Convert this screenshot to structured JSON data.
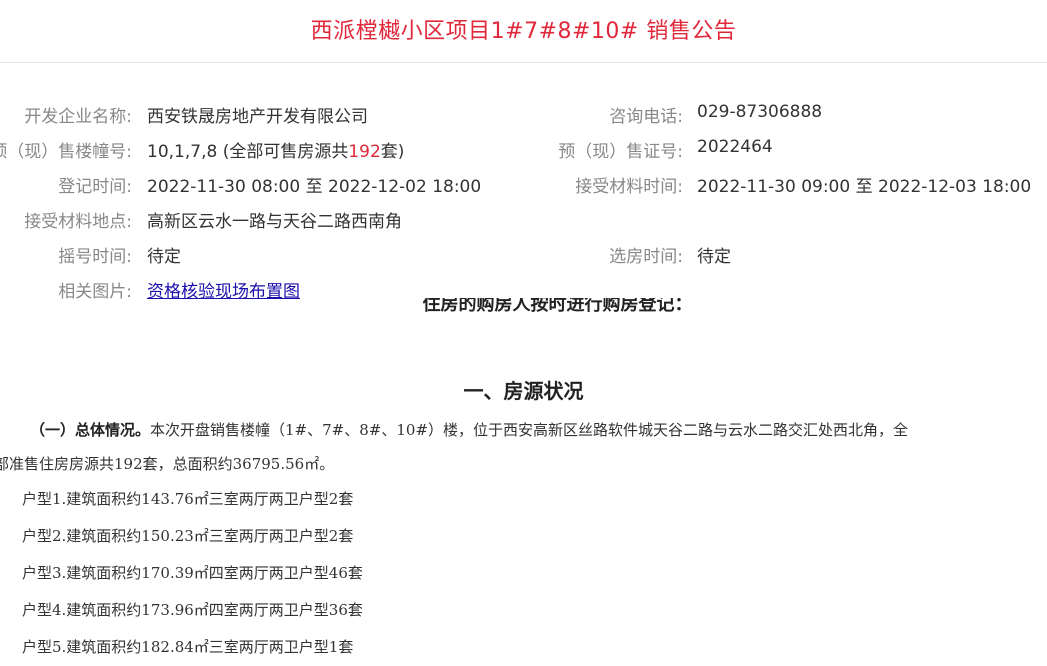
{
  "header": {
    "title": "西派樘樾小区项目1#7#8#10# 销售公告"
  },
  "info": {
    "developer_label": "开发企业名称:",
    "developer_value": "西安铁晟房地产开发有限公司",
    "phone_label": "咨询电话:",
    "phone_value": "029-87306888",
    "buildings_label": "预（现）售楼幢号:",
    "buildings_value_prefix": "10,1,7,8 (全部可售房源共",
    "buildings_count": "192",
    "buildings_value_suffix": "套)",
    "permit_label": "预（现）售证号:",
    "permit_value": "2022464",
    "register_label": "登记时间:",
    "register_value": "2022-11-30 08:00 至 2022-12-02 18:00",
    "accept_time_label": "接受材料时间:",
    "accept_time_value": "2022-11-30 09:00 至 2022-12-03 18:00",
    "accept_place_label": "接受材料地点:",
    "accept_place_value": "高新区云水一路与天谷二路西南角",
    "lottery_label": "摇号时间:",
    "lottery_value": "待定",
    "select_label": "选房时间:",
    "select_value": "待定",
    "images_label": "相关图片:",
    "images_link": "资格核验现场布置图"
  },
  "article": {
    "cut_line": "住房的购房人按时进行购房登记：",
    "section_heading": "一、房源状况",
    "overall_bold": "（一）总体情况。",
    "overall_text1": "本次开盘销售楼幢（1#、7#、8#、10#）楼，位于西安高新区丝路软件城天谷二路与云水二路交汇处西北角，全",
    "overall_text2": "部准售住房房源共192套，总面积约36795.56㎡。",
    "unit_types": [
      "户型1.建筑面积约143.76㎡三室两厅两卫户型2套",
      "户型2.建筑面积约150.23㎡三室两厅两卫户型2套",
      "户型3.建筑面积约170.39㎡四室两厅两卫户型46套",
      "户型4.建筑面积约173.96㎡四室两厅两卫户型36套",
      "户型5.建筑面积约182.84㎡三室两厅两卫户型1套"
    ]
  }
}
